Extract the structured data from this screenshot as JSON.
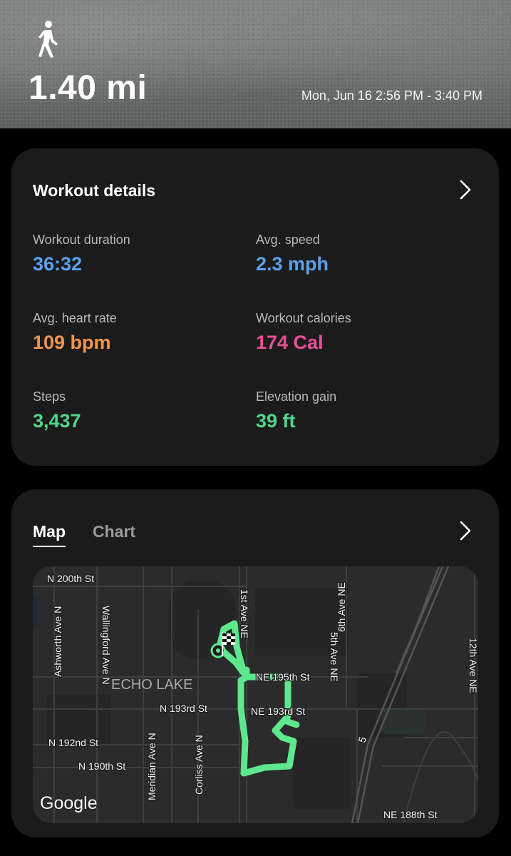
{
  "hero": {
    "activity_icon": "walking-person-icon",
    "distance": "1.40 mi",
    "date_range": "Mon, Jun 16 2:56 PM - 3:40 PM"
  },
  "details": {
    "title": "Workout details",
    "metrics": [
      {
        "label": "Workout duration",
        "value": "36:32",
        "color": "#5aa2f0"
      },
      {
        "label": "Avg. speed",
        "value": "2.3 mph",
        "color": "#5aa2f0"
      },
      {
        "label": "Avg. heart rate",
        "value": "109 bpm",
        "color": "#f0954e"
      },
      {
        "label": "Workout calories",
        "value": "174 Cal",
        "color": "#ec4f97"
      },
      {
        "label": "Steps",
        "value": "3,437",
        "color": "#4fd68a"
      },
      {
        "label": "Elevation gain",
        "value": "39 ft",
        "color": "#4fd68a"
      }
    ]
  },
  "map_card": {
    "tabs": [
      "Map",
      "Chart"
    ],
    "active_tab": "Map",
    "route_color": "#5ee88e",
    "labels": {
      "n200": "N 200th St",
      "ashworth": "Ashworth Ave N",
      "wallingford": "Wallingford Ave N",
      "echo_lake": "ECHO LAKE",
      "n193": "N 193rd St",
      "n192": "N 192nd St",
      "n190": "N 190th St",
      "meridian": "Meridian Ave N",
      "corliss": "Corliss Ave N",
      "first_ave": "1st Ave NE",
      "ne195": "NE 195th St",
      "ne193": "NE 193rd St",
      "fifth_ave": "5th Ave NE",
      "sixth_ave": "6th Ave NE",
      "twelfth_ave": "12th Ave NE",
      "ne188": "NE 188th St",
      "i5": "5",
      "google": "Google"
    }
  }
}
